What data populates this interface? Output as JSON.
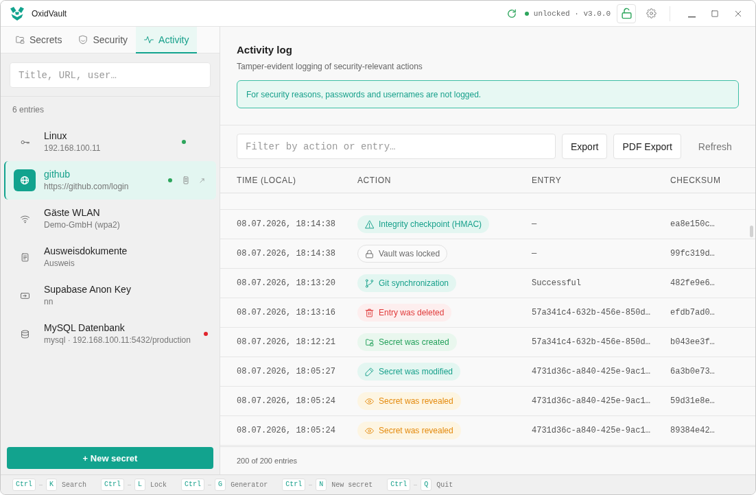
{
  "window": {
    "title": "OxidVault",
    "status": "unlocked · v3.0.0",
    "locked": false
  },
  "tabs": [
    {
      "label": "Secrets",
      "selected": false
    },
    {
      "label": "Security",
      "selected": false
    },
    {
      "label": "Activity",
      "selected": true
    }
  ],
  "sidebar": {
    "search": {
      "placeholder": "Title, URL, user…"
    },
    "count": "6 entries",
    "items": [
      {
        "kind": "ssh",
        "title": "Linux",
        "subtitle": "192.168.100.11",
        "selected": false,
        "dot": {
          "kind": "status",
          "color": "#2da55c"
        }
      },
      {
        "kind": "login",
        "title": "github",
        "subtitle": "https://github.com/login",
        "selected": true,
        "dot": {
          "kind": "status",
          "color": "#2da55c"
        }
      },
      {
        "kind": "wifi",
        "title": "Gäste WLAN",
        "subtitle": "Demo-GmbH (wpa2)",
        "selected": false
      },
      {
        "kind": "note",
        "title": "Ausweisdokumente",
        "subtitle": "Ausweis",
        "selected": false
      },
      {
        "kind": "apikey",
        "title": "Supabase Anon Key",
        "subtitle": "nn",
        "selected": false
      },
      {
        "kind": "database",
        "title": "MySQL Datenbank",
        "subtitle": "mysql · 192.168.100.11:5432/production",
        "selected": false,
        "dot": {
          "kind": "alert",
          "color": "#e0242c"
        }
      }
    ],
    "new_button": "+ New secret"
  },
  "activity": {
    "title": "Activity log",
    "subtitle": "Tamper-evident logging of security-relevant actions",
    "notice": "For security reasons, passwords and usernames are not logged.",
    "filter": {
      "placeholder": "Filter by action or entry…"
    },
    "buttons": [
      "Export",
      "PDF Export"
    ],
    "refresh": "Refresh",
    "table": {
      "columns": [
        "TIME (LOCAL)",
        "ACTION",
        "ENTRY",
        "CHECKSUM"
      ],
      "rows": [
        {
          "time": "08.07.2026, 18:14:38",
          "action": {
            "kind": "integrity",
            "label": "Integrity checkpoint (HMAC)"
          },
          "entry": "—",
          "checksum": "ea8e150c…"
        },
        {
          "time": "08.07.2026, 18:14:38",
          "action": {
            "kind": "locked",
            "label": "Vault was locked"
          },
          "entry": "—",
          "checksum": "99fc319d…"
        },
        {
          "time": "08.07.2026, 18:13:20",
          "action": {
            "kind": "sync",
            "label": "Git synchronization"
          },
          "entry": "Successful",
          "checksum": "482fe9e6…"
        },
        {
          "time": "08.07.2026, 18:13:16",
          "action": {
            "kind": "deleted",
            "label": "Entry was deleted"
          },
          "entry": "57a341c4-632b-456e-850d…",
          "checksum": "efdb7ad0…"
        },
        {
          "time": "08.07.2026, 18:12:21",
          "action": {
            "kind": "created",
            "label": "Secret was created"
          },
          "entry": "57a341c4-632b-456e-850d…",
          "checksum": "b043ee3f…"
        },
        {
          "time": "08.07.2026, 18:05:27",
          "action": {
            "kind": "modified",
            "label": "Secret was modified"
          },
          "entry": "4731d36c-a840-425e-9ac1…",
          "checksum": "6a3b0e73…"
        },
        {
          "time": "08.07.2026, 18:05:24",
          "action": {
            "kind": "revealed",
            "label": "Secret was revealed"
          },
          "entry": "4731d36c-a840-425e-9ac1…",
          "checksum": "59d31e8e…"
        },
        {
          "time": "08.07.2026, 18:05:24",
          "action": {
            "kind": "revealed",
            "label": "Secret was revealed"
          },
          "entry": "4731d36c-a840-425e-9ac1…",
          "checksum": "89384e42…"
        }
      ]
    },
    "footer": "200 of 200 entries"
  },
  "shortcuts": [
    {
      "keys": [
        "Ctrl",
        "K"
      ],
      "label": "Search"
    },
    {
      "keys": [
        "Ctrl",
        "L"
      ],
      "label": "Lock"
    },
    {
      "keys": [
        "Ctrl",
        "G"
      ],
      "label": "Generator"
    },
    {
      "keys": [
        "Ctrl",
        "N"
      ],
      "label": "New secret"
    },
    {
      "keys": [
        "Ctrl",
        "Q"
      ],
      "label": "Quit"
    }
  ]
}
